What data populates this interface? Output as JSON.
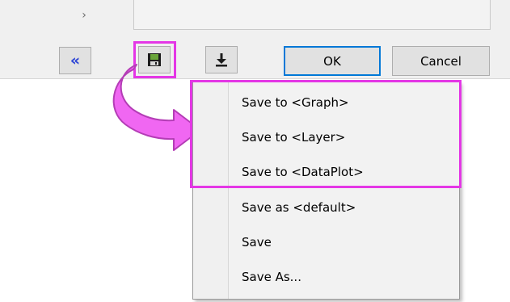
{
  "toolbar": {
    "expander_glyph": "›",
    "collapse_glyph": "«",
    "save_icon": "floppy-disk-icon",
    "download_icon": "download-arrow-icon",
    "ok_label": "OK",
    "cancel_label": "Cancel"
  },
  "menu": {
    "items": [
      {
        "label": "Save to <Graph>"
      },
      {
        "label": "Save to <Layer>"
      },
      {
        "label": "Save to <DataPlot>"
      },
      {
        "label": "Save as <default>"
      },
      {
        "label": "Save"
      },
      {
        "label": "Save As..."
      }
    ]
  },
  "colors": {
    "highlight": "#e437e6",
    "arrow_fill": "#f067f2",
    "collapse_icon": "#2e46d6",
    "ok_border": "#0078d7"
  }
}
